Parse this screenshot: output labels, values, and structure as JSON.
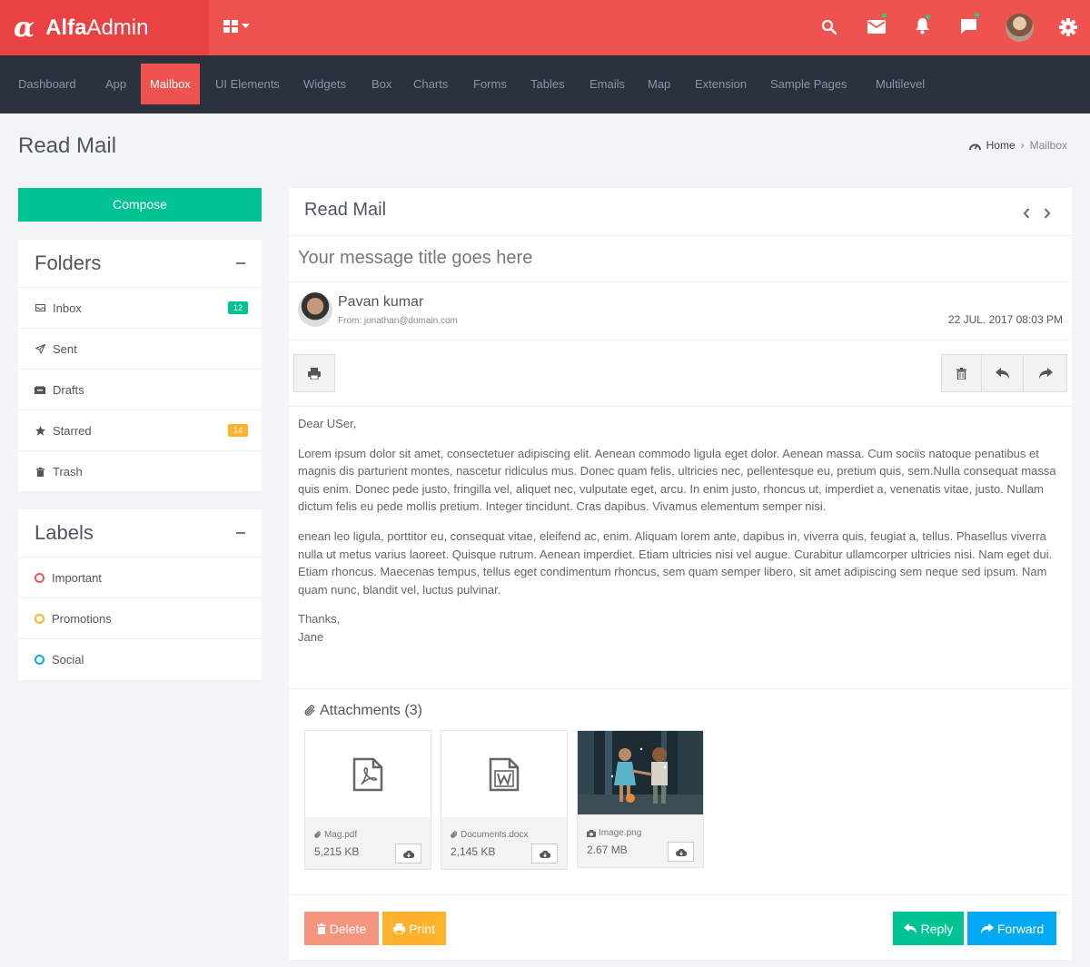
{
  "brand": {
    "bold": "Alfa",
    "light": "Admin"
  },
  "colors": {
    "accent": "#ef5350",
    "success": "#00c292",
    "warning": "#ffb22b",
    "info": "#03a9f3",
    "nav_bg": "#2b323e"
  },
  "topbar_icons": [
    "grid-icon",
    "search-icon",
    "mail-icon",
    "bell-icon",
    "chat-icon",
    "avatar",
    "gear-icon"
  ],
  "nav": [
    "Dashboard",
    "App",
    "Mailbox",
    "UI Elements",
    "Widgets",
    "Box",
    "Charts",
    "Forms",
    "Tables",
    "Emails",
    "Map",
    "Extension",
    "Sample Pages",
    "Multilevel"
  ],
  "nav_active": "Mailbox",
  "page": {
    "title": "Read Mail",
    "breadcrumb": {
      "home": "Home",
      "current": "Mailbox"
    }
  },
  "sidebar": {
    "compose": "Compose",
    "folders_title": "Folders",
    "folders": [
      {
        "label": "Inbox",
        "badge": "12",
        "icon": "inbox-icon"
      },
      {
        "label": "Sent",
        "badge": "",
        "icon": "paper-plane-icon"
      },
      {
        "label": "Drafts",
        "badge": "",
        "icon": "drafts-icon"
      },
      {
        "label": "Starred",
        "badge": "14",
        "icon": "star-icon"
      },
      {
        "label": "Trash",
        "badge": "",
        "icon": "trash-icon"
      }
    ],
    "labels_title": "Labels",
    "labels": [
      {
        "label": "Important",
        "color": "#ef5350"
      },
      {
        "label": "Promotions",
        "color": "#ffb22b"
      },
      {
        "label": "Social",
        "color": "#03a9f3"
      }
    ]
  },
  "mail": {
    "title": "Read Mail",
    "subject": "Your message title goes here",
    "sender": "Pavan kumar",
    "from": "From: jonathan@domain.com",
    "date": "22 JUL. 2017 08:03 PM",
    "greeting": "Dear USer,",
    "para1": "Lorem ipsum dolor sit amet, consectetuer adipiscing elit. Aenean commodo ligula eget dolor. Aenean massa. Cum sociis natoque penatibus et magnis dis parturient montes, nascetur ridiculus mus. Donec quam felis, ultricies nec, pellentesque eu, pretium quis, sem.Nulla consequat massa quis enim. Donec pede justo, fringilla vel, aliquet nec, vulputate eget, arcu. In enim justo, rhoncus ut, imperdiet a, venenatis vitae, justo. Nullam dictum felis eu pede mollis pretium. Integer tincidunt. Cras dapibus. Vivamus elementum semper nisi.",
    "para2": "enean leo ligula, porttitor eu, consequat vitae, eleifend ac, enim. Aliquam lorem ante, dapibus in, viverra quis, feugiat a, tellus. Phasellus viverra nulla ut metus varius laoreet. Quisque rutrum. Aenean imperdiet. Etiam ultricies nisi vel augue. Curabitur ullamcorper ultricies nisi. Nam eget dui. Etiam rhoncus. Maecenas tempus, tellus eget condimentum rhoncus, sem quam semper libero, sit amet adipiscing sem neque sed ipsum. Nam quam nunc, blandit vel, luctus pulvinar.",
    "thanks": "Thanks,",
    "signoff": "Jane",
    "attachments_title": "Attachments (3)",
    "attachments": [
      {
        "name": "Mag.pdf",
        "size": "5,215 KB",
        "icon": "pdf-icon"
      },
      {
        "name": "Documents.docx",
        "size": "2,145 KB",
        "icon": "word-icon"
      },
      {
        "name": "Image.png",
        "size": "2.67 MB",
        "icon": "camera-icon"
      }
    ]
  },
  "buttons": {
    "delete": "Delete",
    "print": "Print",
    "reply": "Reply",
    "forward": "Forward"
  }
}
